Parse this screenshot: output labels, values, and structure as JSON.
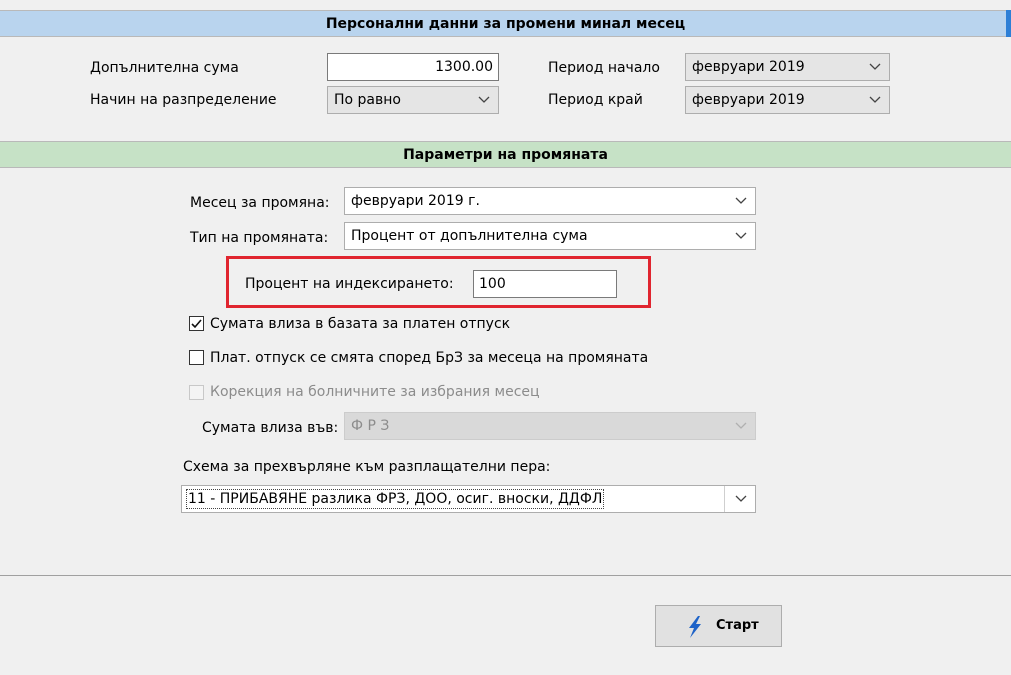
{
  "header": {
    "title": "Персонални данни за промени минал месец"
  },
  "top": {
    "extra_sum_label": "Допълнителна сума",
    "extra_sum_value": "1300.00",
    "distribution_label": "Начин на разпределение",
    "distribution_value": "По равно",
    "period_start_label": "Период начало",
    "period_start_value": "февруари 2019",
    "period_end_label": "Период край",
    "period_end_value": "февруари 2019"
  },
  "params": {
    "title": "Параметри на промяната",
    "month_label": "Месец за промяна:",
    "month_value": "февруари 2019 г.",
    "type_label": "Тип на промяната:",
    "type_value": "Процент от допълнителна сума",
    "percent_label": "Процент на индексирането:",
    "percent_value": "100",
    "chk_vacation_base": {
      "label": "Сумата влиза в базата за платен отпуск",
      "checked": true
    },
    "chk_vacation_brz": {
      "label": "Плат. отпуск се смята според БрЗ за месеца на промяната",
      "checked": false
    },
    "chk_sick_correction": {
      "label": "Корекция на болничните за избрания месец",
      "checked": false,
      "disabled": true
    },
    "sum_in_label": "Сумата влиза във:",
    "sum_in_value": "Ф Р З",
    "scheme_label": "Схема за прехвърляне към разплащателни пера:",
    "scheme_value": "11 - ПРИБАВЯНЕ разлика ФРЗ, ДОО, осиг. вноски, ДДФЛ"
  },
  "footer": {
    "start_label": "Старт"
  },
  "colors": {
    "highlight": "#e0252f",
    "header_blue": "#b9d4ee",
    "header_green": "#c6e2c6"
  }
}
